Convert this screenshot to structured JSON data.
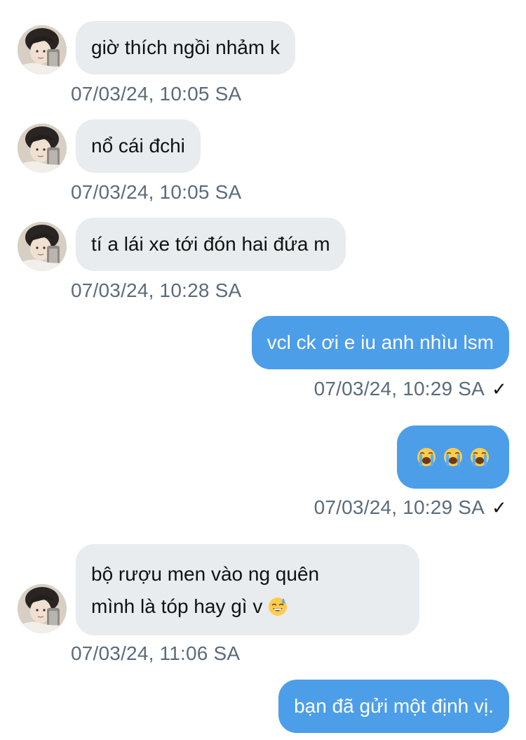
{
  "messages": [
    {
      "direction": "in",
      "text": "giờ thích ngồi nhảm k",
      "time": "07/03/24, 10:05 SA"
    },
    {
      "direction": "in",
      "text": "nổ cái đchi",
      "time": "07/03/24, 10:05 SA"
    },
    {
      "direction": "in",
      "text": "tí a lái xe tới đón hai đứa m",
      "time": "07/03/24, 10:28 SA"
    },
    {
      "direction": "out",
      "text": "vcl ck ơi e iu anh nhìu lsm",
      "time": "07/03/24, 10:29 SA",
      "status_icon": "check-icon",
      "status_glyph": "✓"
    },
    {
      "direction": "out",
      "emojis": [
        "loudly-crying-face-icon",
        "loudly-crying-face-icon",
        "loudly-crying-face-icon"
      ],
      "time": "07/03/24, 10:29 SA",
      "status_icon": "check-icon",
      "status_glyph": "✓"
    },
    {
      "direction": "in",
      "lines": [
        "bộ rượu men vào ng quên",
        "mình là tóp hay gì v"
      ],
      "trailing_emoji": "grinning-face-with-sweat-icon",
      "time": "07/03/24, 11:06 SA"
    },
    {
      "direction": "out",
      "text": "bạn đã gửi một định vị."
    }
  ],
  "colors": {
    "incoming_bubble": "#e8ecef",
    "outgoing_bubble": "#4c9ee8",
    "timestamp": "#5b6b7b"
  }
}
